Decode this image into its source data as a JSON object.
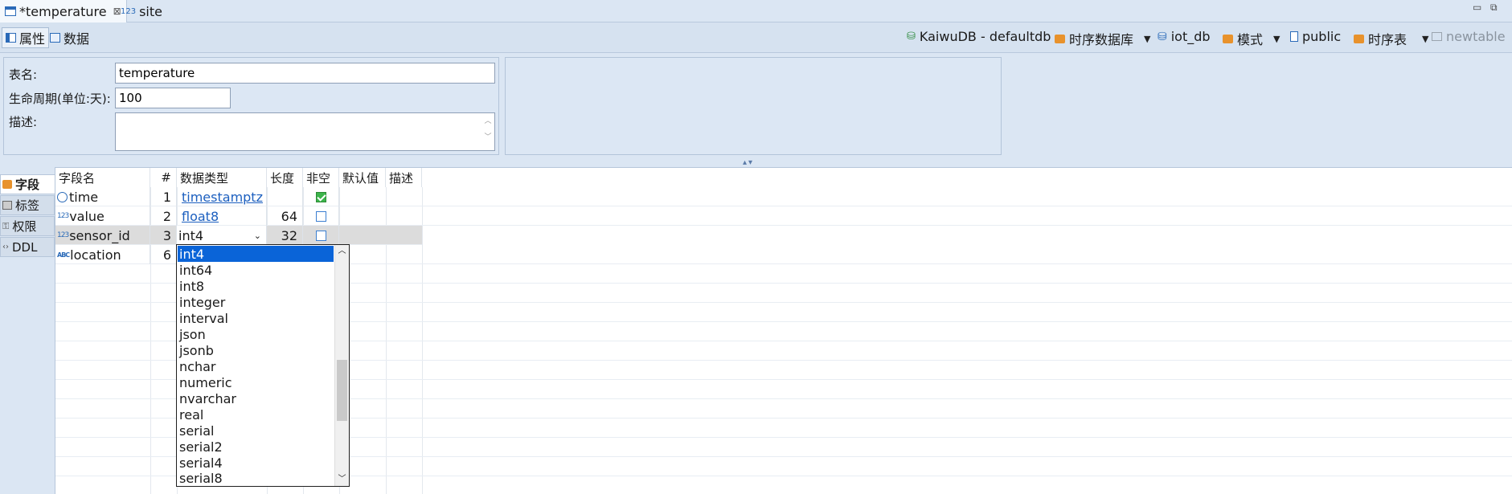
{
  "tabs": [
    {
      "label": "*temperature",
      "icon": "table-icon",
      "active": true
    },
    {
      "label": "site",
      "icon": "numeric-icon",
      "prefix": "123",
      "active": false
    }
  ],
  "subtabs": [
    {
      "label": "属性",
      "icon": "properties-icon"
    },
    {
      "label": "数据",
      "icon": "data-icon"
    }
  ],
  "breadcrumb": {
    "connection": "KaiwuDB - defaultdb",
    "database": "时序数据库",
    "db_name": "iot_db",
    "schema_label": "模式",
    "schema_name": "public",
    "table_type": "时序表",
    "new_table": "newtable"
  },
  "properties": {
    "table_name_label": "表名:",
    "table_name_value": "temperature",
    "lifecycle_label": "生命周期(单位:天):",
    "lifecycle_value": "100",
    "description_label": "描述:",
    "description_value": ""
  },
  "side_tabs": [
    {
      "label": "字段",
      "icon": "field-icon",
      "active": true
    },
    {
      "label": "标签",
      "icon": "tag-icon",
      "active": false
    },
    {
      "label": "权限",
      "icon": "key-icon",
      "active": false
    },
    {
      "label": "DDL",
      "icon": "ddl-icon",
      "active": false
    }
  ],
  "columns": {
    "name": "字段名",
    "num": "#",
    "type": "数据类型",
    "length": "长度",
    "not_null": "非空",
    "default": "默认值",
    "desc": "描述"
  },
  "rows": [
    {
      "name": "time",
      "icon": "clock-icon",
      "num": "1",
      "type": "timestamptz",
      "length": "",
      "not_null": true
    },
    {
      "name": "value",
      "icon": "numeric-icon",
      "icon_text": "123",
      "num": "2",
      "type": "float8",
      "length": "64",
      "not_null": false
    },
    {
      "name": "sensor_id",
      "icon": "numeric-icon",
      "icon_text": "123",
      "num": "3",
      "type": "int4",
      "length": "32",
      "not_null": false
    },
    {
      "name": "location",
      "icon": "text-icon",
      "icon_text": "ABC",
      "num": "6",
      "type": "",
      "length": "",
      "not_null": false
    }
  ],
  "dropdown_options": [
    "int4",
    "int64",
    "int8",
    "integer",
    "interval",
    "json",
    "jsonb",
    "nchar",
    "numeric",
    "nvarchar",
    "real",
    "serial",
    "serial2",
    "serial4",
    "serial8"
  ],
  "dropdown_selected": "int4",
  "colors": {
    "accent": "#0a64d8",
    "link": "#1c5fbf",
    "panel_bg": "#dce7f4"
  }
}
